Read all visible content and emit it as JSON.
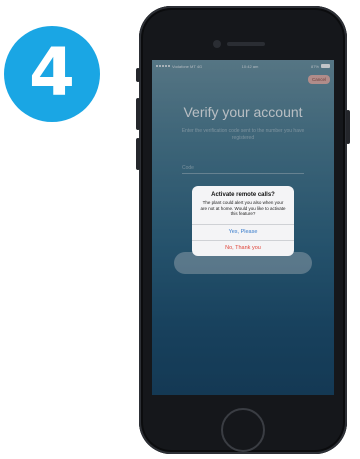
{
  "step": {
    "number": "4",
    "color": "#1aa6e4"
  },
  "status_bar": {
    "carrier": "Vodafone MT 4G",
    "time": "10:42 am",
    "battery": "87%"
  },
  "screen": {
    "cancel_label": "Cancel",
    "title": "Verify your account",
    "subtitle": "Enter the verification code sent to the number you have registered",
    "code_field_label": "Code"
  },
  "alert": {
    "title": "Activate remote calls?",
    "message": "The plant could alert you also when your are not at home. Would you like to activate this feature?",
    "yes_label": "Yes, Please",
    "no_label": "No, Thank you"
  }
}
